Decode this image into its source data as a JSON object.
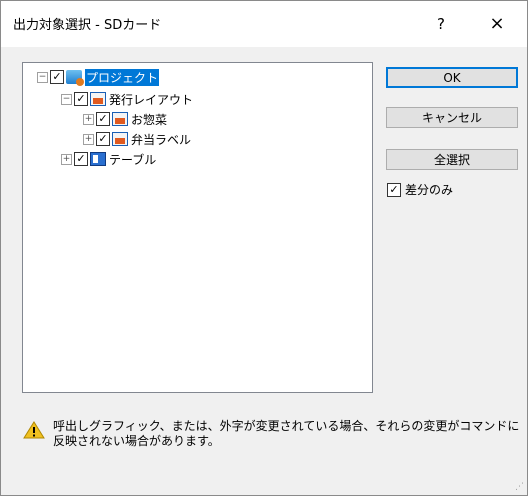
{
  "window": {
    "title": "出力対象選択 - SDカード",
    "help": "?",
    "close": "×"
  },
  "tree": {
    "nodes": [
      {
        "label": "プロジェクト",
        "expander": "−",
        "check": "✓",
        "icon": "project-icon",
        "selected": true
      },
      {
        "label": "発行レイアウト",
        "expander": "−",
        "check": "✓",
        "icon": "layout-folder-icon"
      },
      {
        "label": "お惣菜",
        "expander": "+",
        "check": "✓",
        "icon": "layout-icon"
      },
      {
        "label": "弁当ラベル",
        "expander": "+",
        "check": "✓",
        "icon": "layout-icon"
      },
      {
        "label": "テーブル",
        "expander": "+",
        "check": "✓",
        "icon": "table-icon"
      }
    ]
  },
  "buttons": {
    "ok": "OK",
    "cancel": "キャンセル",
    "select_all": "全選択"
  },
  "options": {
    "diff_only_label": "差分のみ",
    "diff_only_check": "✓"
  },
  "warning": {
    "icon": "warning-icon",
    "text": "呼出しグラフィック、または、外字が変更されている場合、それらの変更がコマンドに反映されない場合があります。"
  },
  "colors": {
    "selection": "#0078d7",
    "warning": "#f0c020"
  }
}
